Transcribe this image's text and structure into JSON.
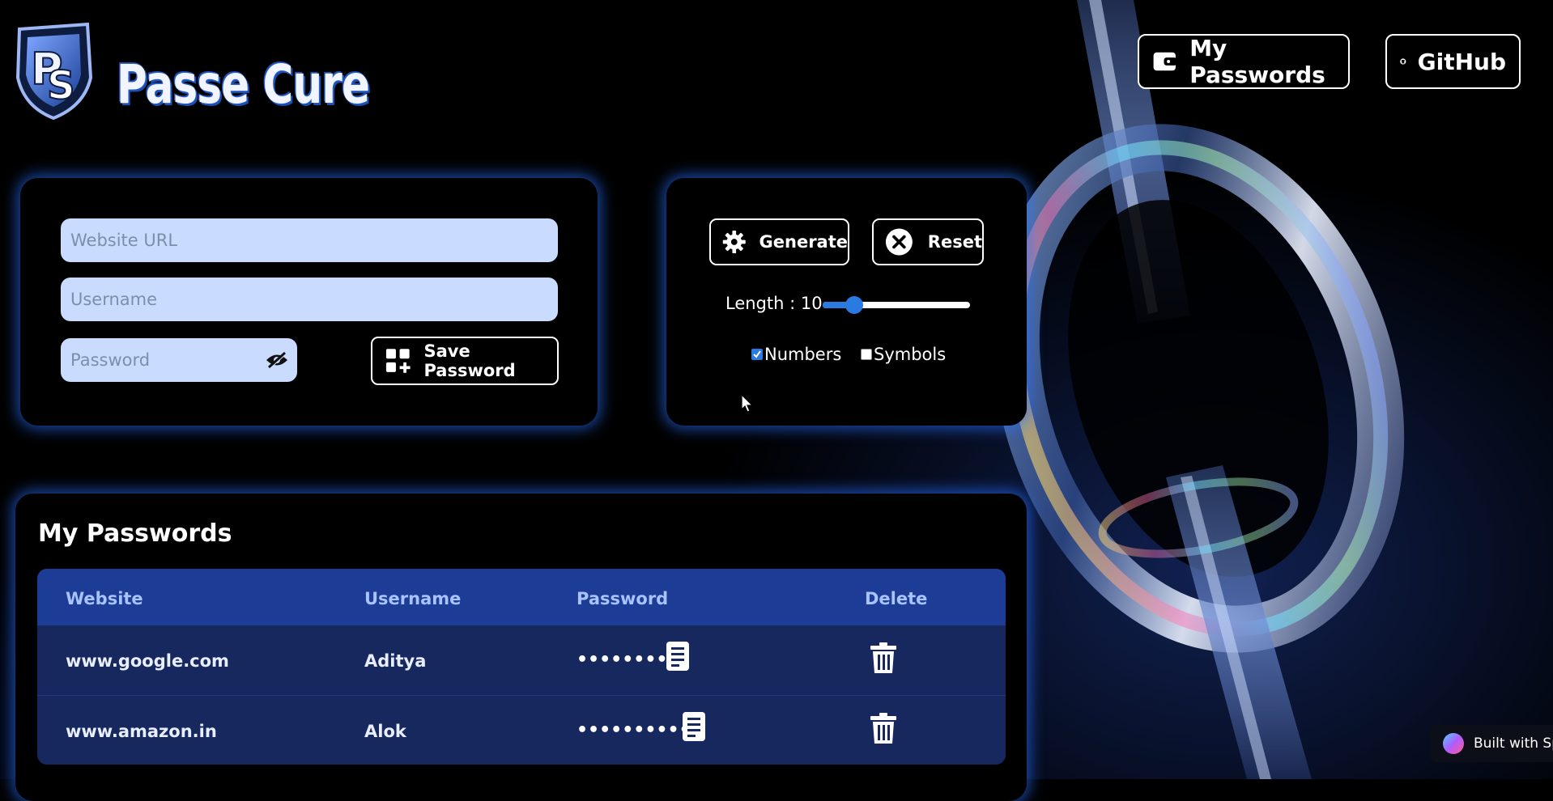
{
  "app": {
    "logo_text": "Passe Cure",
    "logo_monogram": "PS"
  },
  "nav": {
    "my_passwords_label": "My Passwords",
    "github_label": "GitHub"
  },
  "form": {
    "website_placeholder": "Website URL",
    "username_placeholder": "Username",
    "password_placeholder": "Password",
    "save_label": "Save Password"
  },
  "generator": {
    "generate_label": "Generate",
    "reset_label": "Reset",
    "length_label": "Length : 10",
    "length_value": 10,
    "length_min": 4,
    "length_max": 32,
    "numbers_label": "Numbers",
    "numbers_checked": true,
    "symbols_label": "Symbols",
    "symbols_checked": false
  },
  "passwords": {
    "title": "My Passwords",
    "columns": [
      "Website",
      "Username",
      "Password",
      "Delete"
    ],
    "rows": [
      {
        "website": "www.google.com",
        "username": "Aditya",
        "password_mask": "••••••••••"
      },
      {
        "website": "www.amazon.in",
        "username": "Alok",
        "password_mask": "•••••••••••"
      }
    ]
  },
  "badge": {
    "label": "Built with Spli"
  },
  "colors": {
    "accent_glow": "#2a6eff",
    "input_bg": "#c9dcff",
    "table_header": "#1d3c96",
    "table_body": "#16285e"
  }
}
